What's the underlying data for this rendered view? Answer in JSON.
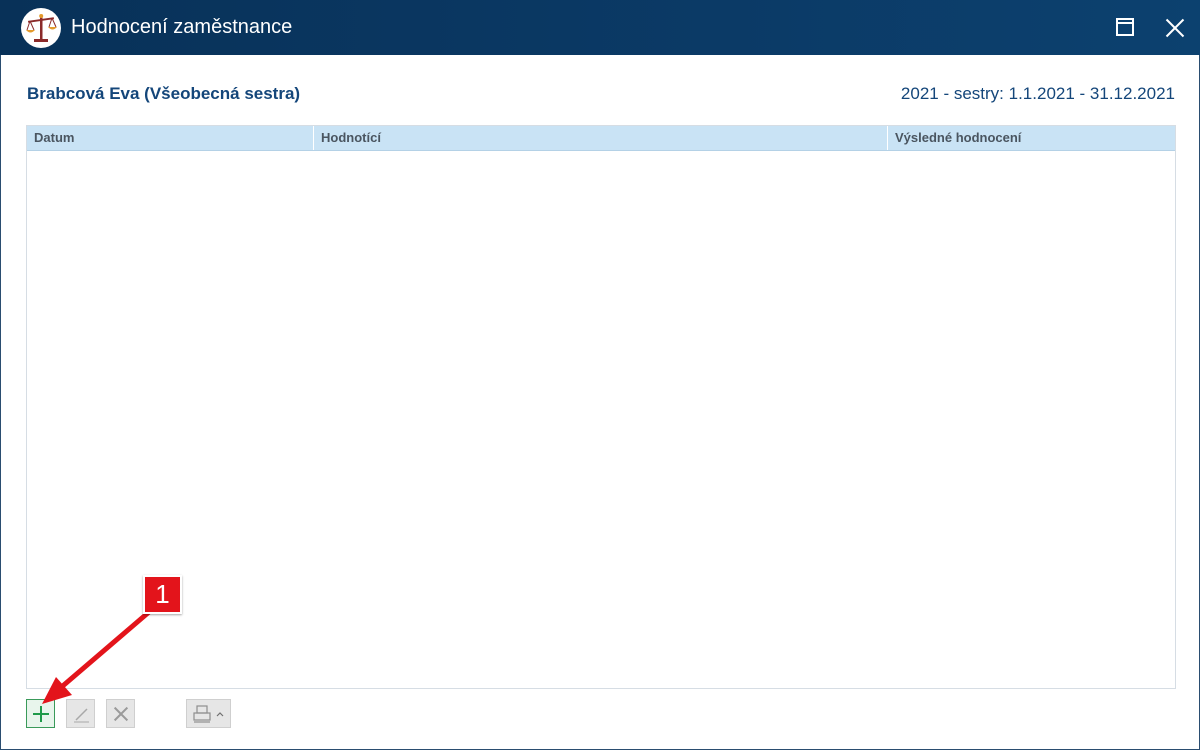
{
  "window": {
    "title": "Hodnocení zaměstnance",
    "icons": {
      "app": "scales-icon",
      "maximize": "maximize-icon",
      "close": "close-icon"
    }
  },
  "employee": {
    "name": "Brabcová Eva (Všeobecná sestra)",
    "period": "2021 - sestry: 1.1.2021 - 31.12.2021"
  },
  "table": {
    "columns": [
      "Datum",
      "Hodnotící",
      "Výsledné hodnocení"
    ],
    "rows": []
  },
  "toolbar": {
    "buttons": [
      {
        "name": "add",
        "icon": "plus-icon",
        "enabled": true
      },
      {
        "name": "edit",
        "icon": "pencil-icon",
        "enabled": false
      },
      {
        "name": "delete",
        "icon": "x-icon",
        "enabled": false
      },
      {
        "name": "print",
        "icon": "printer-icon",
        "enabled": false
      }
    ]
  },
  "annotation": {
    "label": "1",
    "color": "#e3141b"
  },
  "colors": {
    "titlebar": "#0b3a66",
    "accent_text": "#14467a",
    "header_bg": "#c9e3f5",
    "add_green": "#1f9a4a"
  }
}
